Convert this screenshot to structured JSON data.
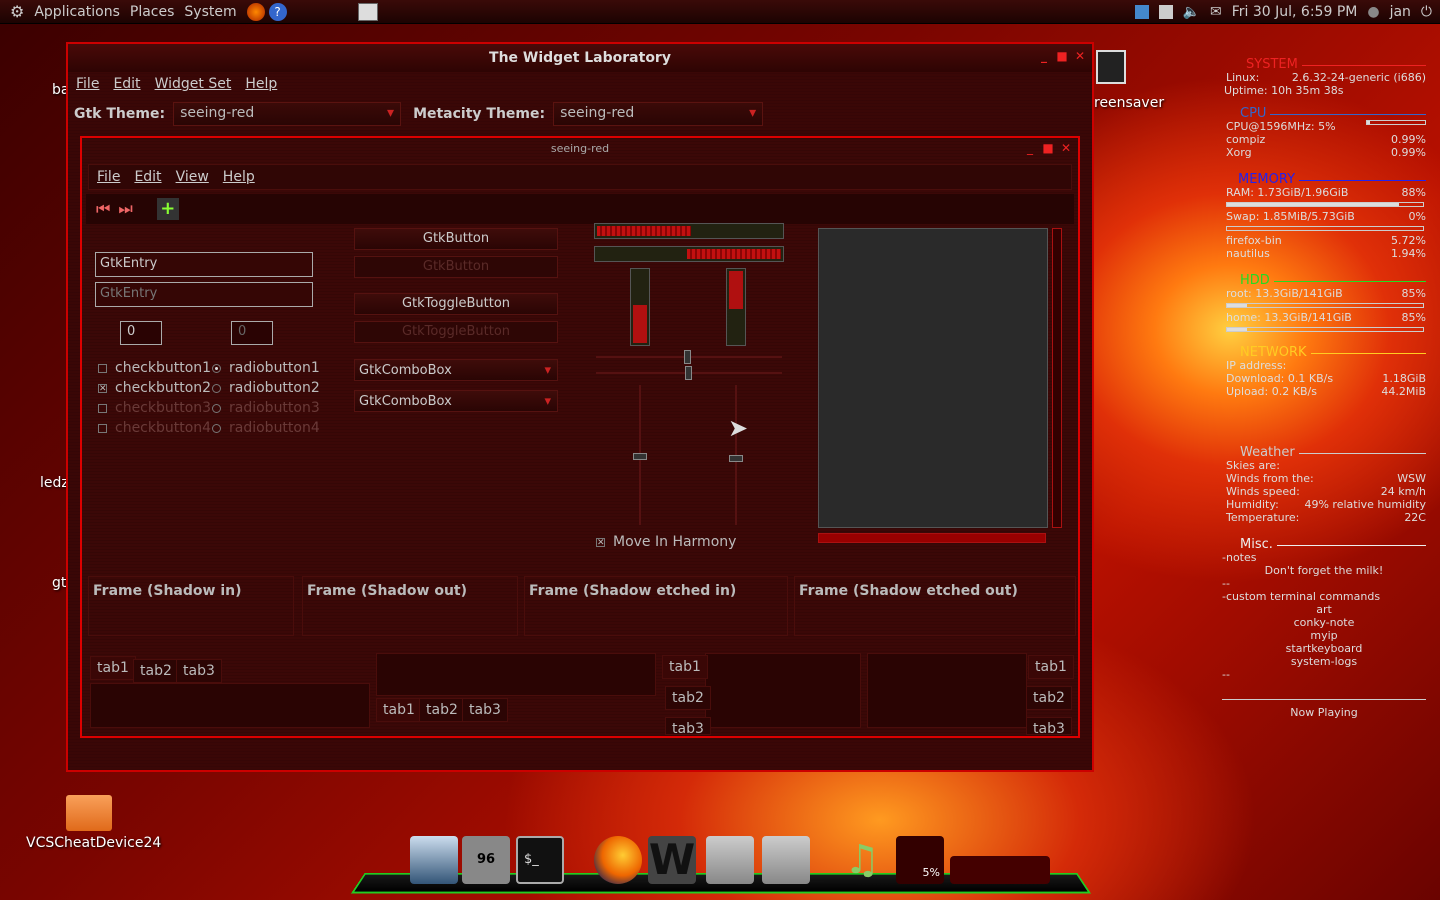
{
  "top_panel": {
    "menus": [
      "Applications",
      "Places",
      "System"
    ],
    "clock": "Fri 30 Jul,  6:59 PM",
    "user": "jan"
  },
  "desktop": {
    "icons": [
      "VCSCheatDevice24"
    ],
    "partial_labels": [
      "ba",
      "ledz",
      "gt",
      "reensaver"
    ]
  },
  "outer_window": {
    "title": "The Widget Laboratory",
    "menu": [
      "File",
      "Edit",
      "Widget Set",
      "Help"
    ],
    "gtk_theme_label": "Gtk Theme:",
    "gtk_theme_value": "seeing-red",
    "metacity_theme_label": "Metacity Theme:",
    "metacity_theme_value": "seeing-red"
  },
  "inner_window": {
    "title": "seeing-red",
    "menu": [
      "File",
      "Edit",
      "View",
      "Help"
    ],
    "entry1": "GtkEntry",
    "entry2": "GtkEntry",
    "spin1": "0",
    "spin2": "0",
    "button1": "GtkButton",
    "button2": "GtkButton",
    "toggle1": "GtkToggleButton",
    "toggle2": "GtkToggleButton",
    "combo1": "GtkComboBox",
    "combo2": "GtkComboBox",
    "checks": [
      "checkbutton1",
      "checkbutton2",
      "checkbutton3",
      "checkbutton4"
    ],
    "radios": [
      "radiobutton1",
      "radiobutton2",
      "radiobutton3",
      "radiobutton4"
    ],
    "move_in_harmony": "Move In Harmony",
    "progress": {
      "h1": 0.5,
      "h2": 0.5,
      "v1": 0.5,
      "v2": 0.5
    },
    "frames": [
      "Frame (Shadow in)",
      "Frame (Shadow out)",
      "Frame (Shadow etched in)",
      "Frame (Shadow etched out)"
    ],
    "tabs": [
      "tab1",
      "tab2",
      "tab3"
    ]
  },
  "conky": {
    "system": {
      "title": "SYSTEM",
      "linux_label": "Linux:",
      "linux": "2.6.32-24-generic (i686)",
      "uptime": "Uptime: 10h 35m 38s"
    },
    "cpu": {
      "title": "CPU",
      "freq": "CPU@1596MHz: 5%",
      "usage": 0.05,
      "procs": [
        {
          "name": "compiz",
          "val": "0.99%"
        },
        {
          "name": "Xorg",
          "val": "0.99%"
        }
      ]
    },
    "memory": {
      "title": "MEMORY",
      "ram": "RAM: 1.73GiB/1.96GiB",
      "ram_pct": "88%",
      "ram_frac": 0.88,
      "swap": "Swap: 1.85MiB/5.73GiB",
      "swap_pct": "0%",
      "swap_frac": 0.0,
      "procs": [
        {
          "name": "firefox-bin",
          "val": "5.72%"
        },
        {
          "name": "nautilus",
          "val": "1.94%"
        }
      ]
    },
    "hdd": {
      "title": "HDD",
      "root": "root: 13.3GiB/141GiB",
      "root_pct": "85%",
      "home": "home: 13.3GiB/141GiB",
      "home_pct": "85%",
      "root_used_frac": 0.1,
      "home_used_frac": 0.1
    },
    "network": {
      "title": "NETWORK",
      "ip": "IP address:",
      "down": "Download: 0.1 KB/s",
      "down_total": "1.18GiB",
      "up": "Upload: 0.2 KB/s",
      "up_total": "44.2MiB"
    },
    "weather": {
      "title": "Weather",
      "skies": "Skies are:",
      "wind_from_label": "Winds from the:",
      "wind_from": "WSW",
      "wind_speed_label": "Winds speed:",
      "wind_speed": "24 km/h",
      "humidity_label": "Humidity:",
      "humidity": "49% relative humidity",
      "temp_label": "Temperature:",
      "temp": "22C"
    },
    "misc": {
      "title": "Misc.",
      "notes": "-notes",
      "note1": "Don't forget the milk!",
      "sep": "--",
      "cmds": "-custom terminal commands",
      "list": [
        "art",
        "conky-note",
        "myip",
        "startkeyboard",
        "system-logs"
      ],
      "sep2": "--"
    },
    "now_playing": "Now Playing"
  },
  "dock": {
    "trash_count": "96",
    "percent": "5%"
  }
}
